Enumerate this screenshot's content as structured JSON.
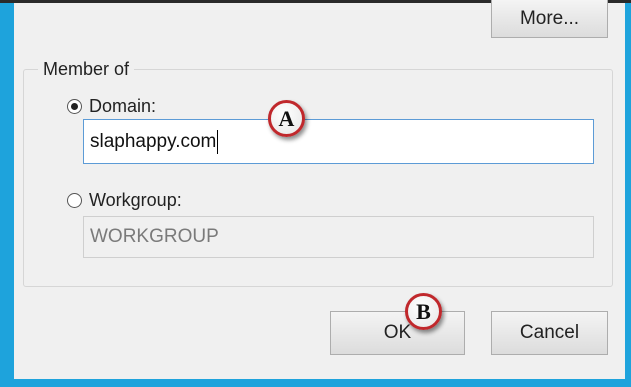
{
  "dialog": {
    "more_button": "More...",
    "member_of": {
      "title": "Member of",
      "domain_label": "Domain:",
      "domain_value": "slaphappy.com",
      "domain_selected": true,
      "workgroup_label": "Workgroup:",
      "workgroup_value": "WORKGROUP",
      "workgroup_selected": false
    },
    "ok_button": "OK",
    "cancel_button": "Cancel"
  },
  "callouts": {
    "a": "A",
    "b": "B"
  },
  "colors": {
    "window_border": "#1ea3dc",
    "callout_ring": "#c0282c",
    "focus_border": "#5c9bd6"
  }
}
